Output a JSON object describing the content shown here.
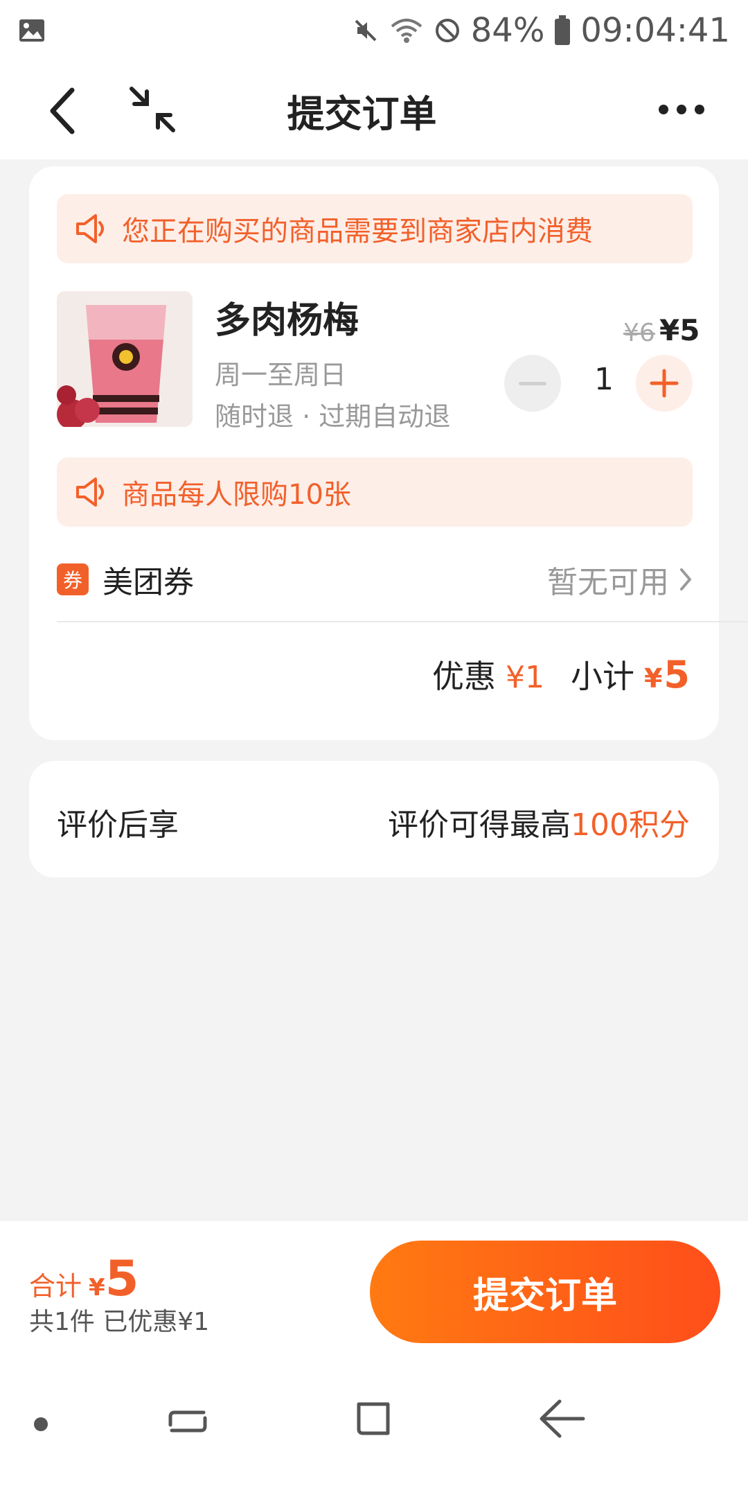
{
  "status_bar": {
    "battery": "84%",
    "time": "09:04:41"
  },
  "header": {
    "title": "提交订单"
  },
  "order": {
    "notice_consume": "您正在购买的商品需要到商家店内消费",
    "product": {
      "name": "多肉杨梅",
      "days": "周一至周日",
      "refund": "随时退 · 过期自动退",
      "price_old": "¥6",
      "price_new": "¥5",
      "quantity": "1"
    },
    "notice_limit": "商品每人限购10张",
    "coupon": {
      "badge": "券",
      "label": "美团券",
      "status": "暂无可用"
    },
    "summary": {
      "discount_label": "优惠",
      "discount_value": "¥1",
      "subtotal_label": "小计",
      "subtotal_currency": "¥",
      "subtotal_value": "5"
    }
  },
  "review": {
    "left": "评价后享",
    "right_prefix": "评价可得最高",
    "right_highlight": "100积分"
  },
  "bottom": {
    "total_label": "合计",
    "total_currency": "¥",
    "total_value": "5",
    "total_sub": "共1件  已优惠¥1",
    "submit_label": "提交订单"
  },
  "colors": {
    "accent": "#f2602a",
    "notice_bg": "#fdeee8",
    "page_bg": "#f3f3f3"
  }
}
